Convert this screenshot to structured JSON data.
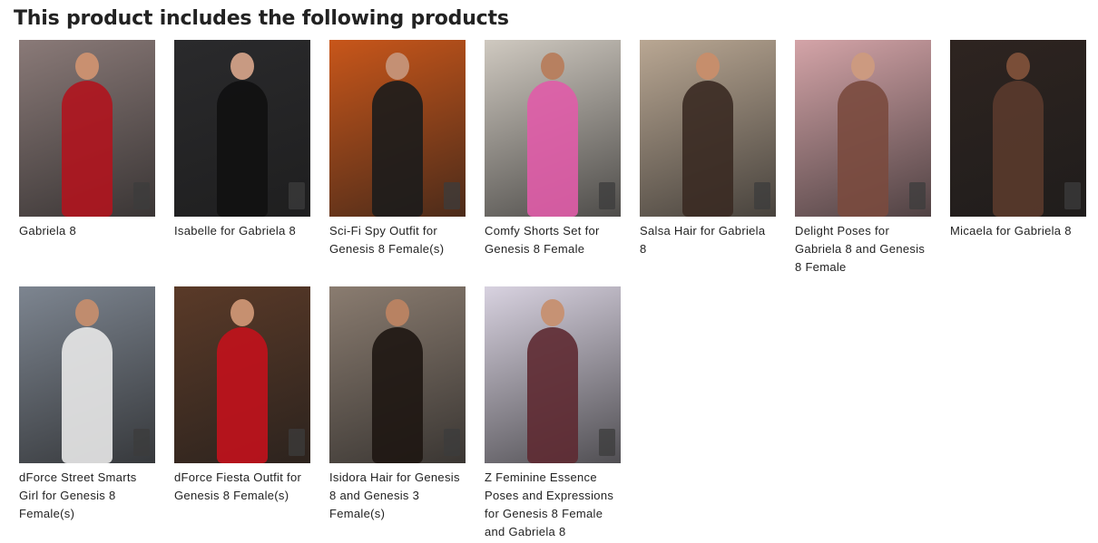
{
  "heading": "This product includes the following products",
  "products": [
    {
      "title": "Gabriela 8",
      "bg": "#8a7a78",
      "fig": "#b0141e",
      "head": "#c99070"
    },
    {
      "title": "Isabelle for Gabriela 8",
      "bg": "#2a2a2c",
      "fig": "#111111",
      "head": "#c89a82"
    },
    {
      "title": "Sci-Fi Spy Outfit for Genesis 8 Female(s)",
      "bg": "#c8561a",
      "fig": "#1c1c1c",
      "head": "#c49074"
    },
    {
      "title": "Comfy Shorts Set for Genesis 8 Female",
      "bg": "#cfc9c0",
      "fig": "#e05ca8",
      "head": "#b78060"
    },
    {
      "title": "Salsa Hair for Gabriela 8",
      "bg": "#b9a793",
      "fig": "#3a2a22",
      "head": "#c68e6c"
    },
    {
      "title": "Delight Poses for Gabriela 8 and Genesis 8 Female",
      "bg": "#d4a4a8",
      "fig": "#7a4a3e",
      "head": "#cc9a80"
    },
    {
      "title": "Micaela for Gabriela 8",
      "bg": "#2e2420",
      "fig": "#5a3a2c",
      "head": "#7a4e38"
    },
    {
      "title": "dForce Street Smarts Girl for Genesis 8 Female(s)",
      "bg": "#7d8590",
      "fig": "#e8e8e8",
      "head": "#c08c6e"
    },
    {
      "title": "dForce Fiesta Outfit for Genesis 8 Female(s)",
      "bg": "#5a3a28",
      "fig": "#c2121c",
      "head": "#c69070"
    },
    {
      "title": "Isidora Hair for Genesis 8 and Genesis 3 Female(s)",
      "bg": "#8a7c70",
      "fig": "#1e1612",
      "head": "#b88262"
    },
    {
      "title": "Z Feminine Essence Poses and Expressions for Genesis 8 Female and Gabriela 8",
      "bg": "#d8d2e0",
      "fig": "#5e2a32",
      "head": "#c69274"
    }
  ]
}
